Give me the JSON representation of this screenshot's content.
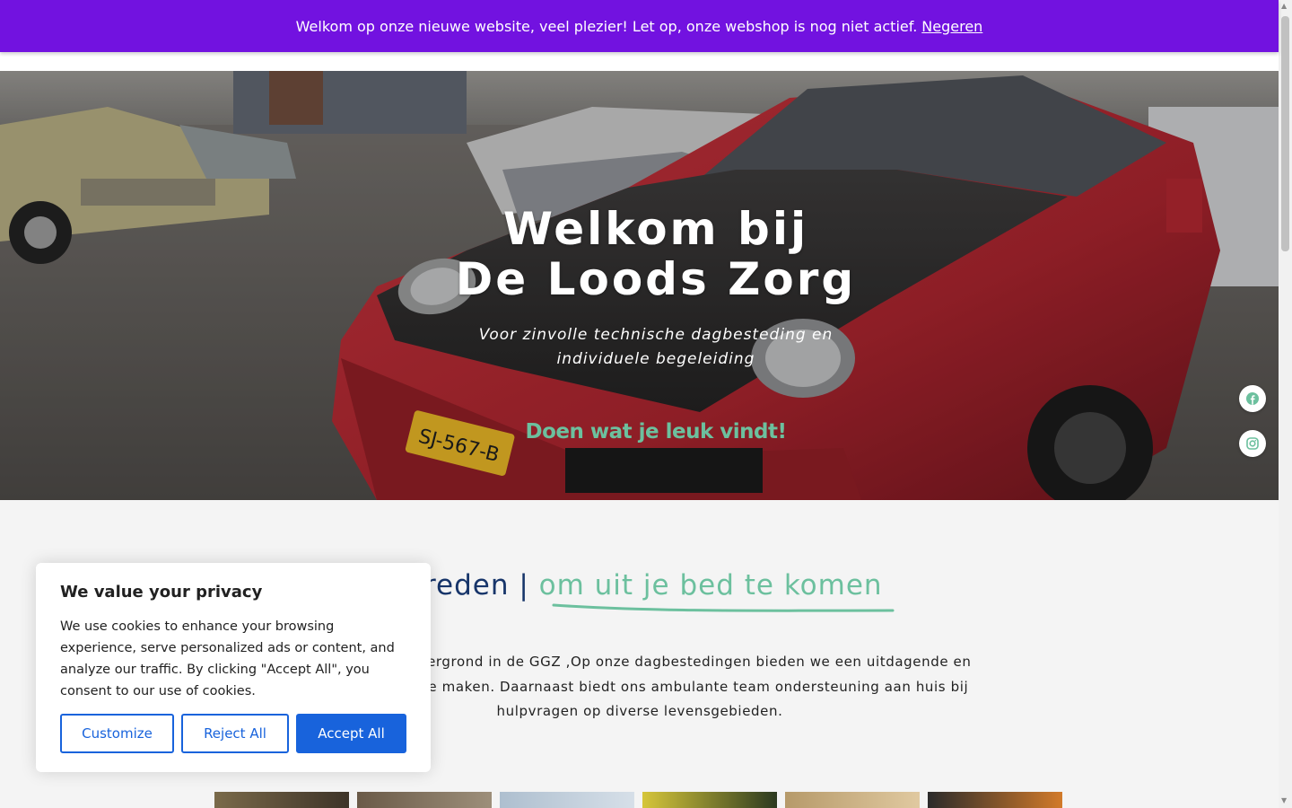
{
  "notice": {
    "message": "Welkom op onze nieuwe website, veel plezier! Let op, onze webshop is nog niet actief.",
    "dismiss_label": "Negeren"
  },
  "hero": {
    "title_line1": "Welkom bij",
    "title_line2": "De Loods Zorg",
    "subtitle_line1": "Voor zinvolle technische dagbesteding en",
    "subtitle_line2": "individuele begeleiding",
    "tagline": "Doen wat je leuk vindt!",
    "plate": "SJ-567-B"
  },
  "social": {
    "facebook_icon": "facebook-icon",
    "instagram_icon": "instagram-icon"
  },
  "section": {
    "heading_main": "n reden |",
    "heading_accent": "om uit je bed te komen",
    "intro_line1": "en met een achtergrond in de GGZ ,Op onze dagbestedingen bieden we een uitdagende en",
    "intro_line2": "m toffe dingen te maken. Daarnaast biedt ons ambulante team ondersteuning aan huis bij",
    "intro_line3": "hulpvragen op diverse levensgebieden."
  },
  "cookie": {
    "title": "We value your privacy",
    "body": "We use cookies to enhance your browsing experience, serve personalized ads or content, and analyze our traffic. By clicking \"Accept All\", you consent to our use of cookies.",
    "customize_label": "Customize",
    "reject_label": "Reject All",
    "accept_label": "Accept All"
  },
  "colors": {
    "notice_bg": "#7212e0",
    "accent_green": "#6cc09e",
    "heading_navy": "#17356a",
    "cookie_blue": "#1863dc"
  }
}
